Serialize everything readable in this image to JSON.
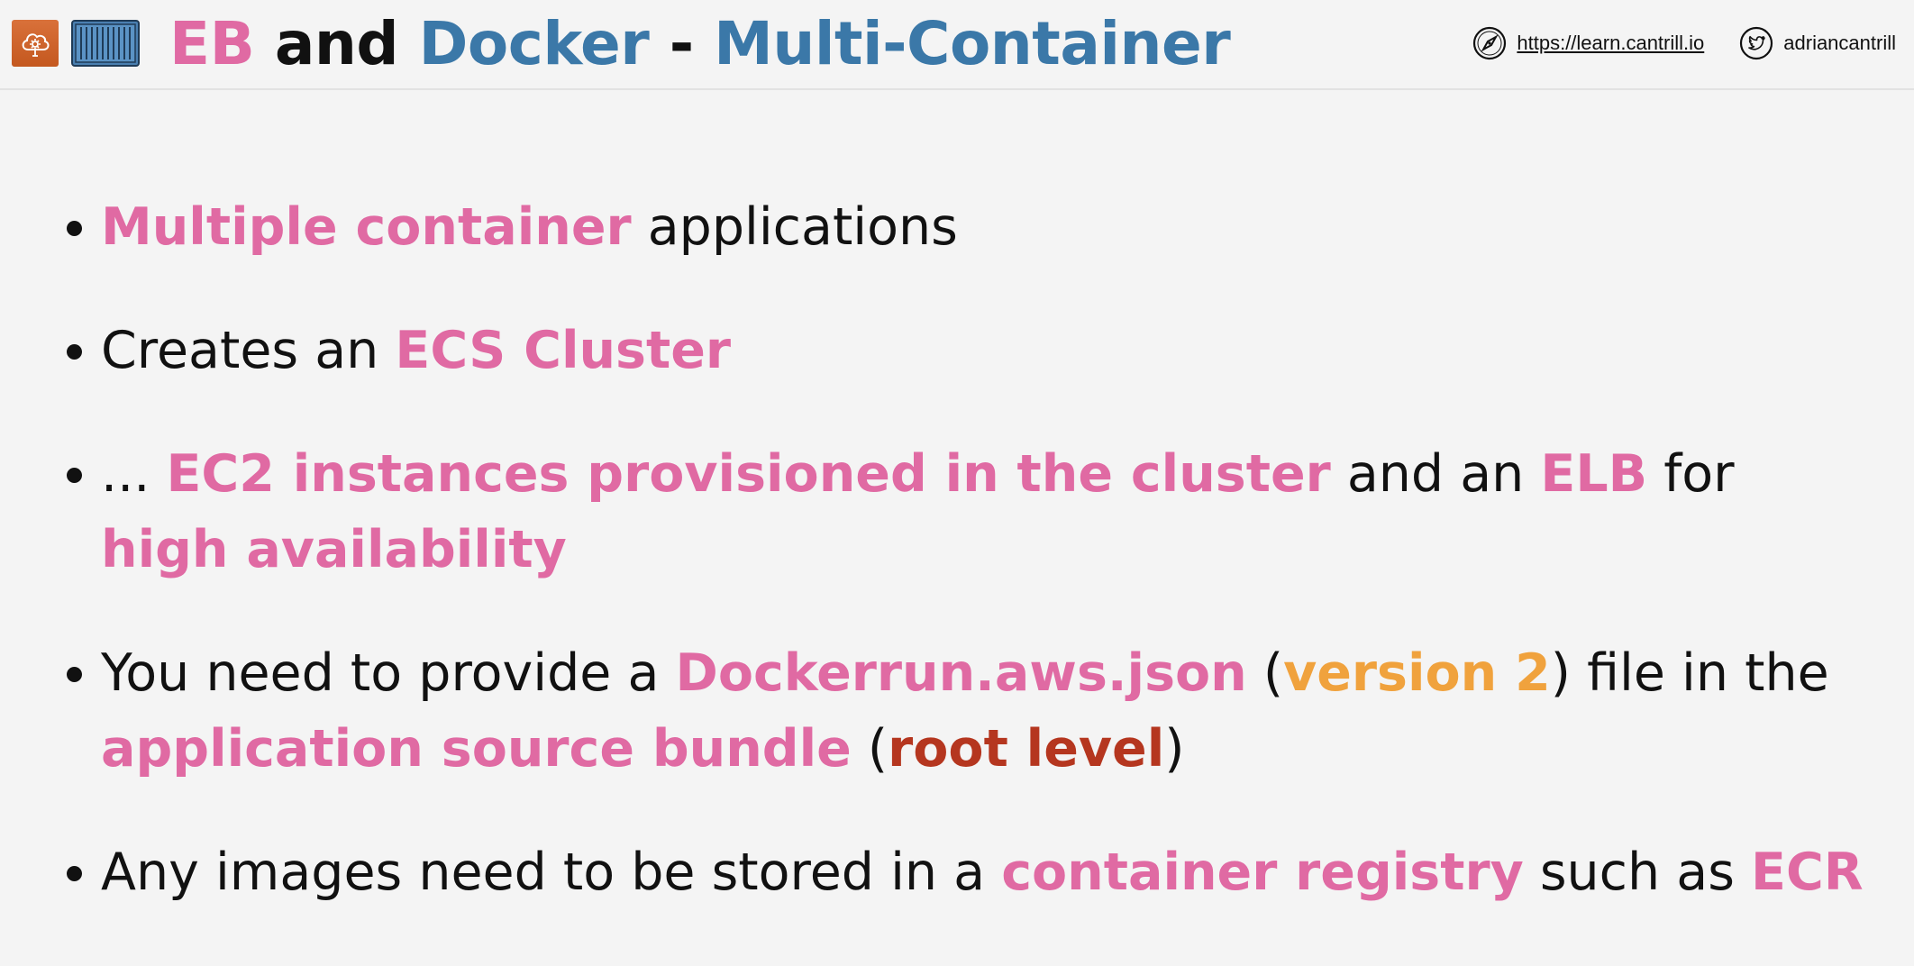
{
  "header": {
    "title": {
      "part1": "EB",
      "part2": " and ",
      "part3": "Docker",
      "part4": " - ",
      "part5": "Multi-Container"
    },
    "website": "https://learn.cantrill.io",
    "twitter": "adriancantrill",
    "icons": [
      "elastic-beanstalk-icon",
      "container-icon",
      "compass-icon",
      "twitter-bird-icon"
    ]
  },
  "bullets": [
    {
      "segments": [
        {
          "text": "Multiple container",
          "style": "pink"
        },
        {
          "text": " applications",
          "style": "normal"
        }
      ]
    },
    {
      "segments": [
        {
          "text": "Creates an ",
          "style": "normal"
        },
        {
          "text": "ECS Cluster",
          "style": "pink"
        }
      ]
    },
    {
      "segments": [
        {
          "text": "... ",
          "style": "normal"
        },
        {
          "text": "EC2 instances provisioned in the cluster",
          "style": "pink"
        },
        {
          "text": " and an ",
          "style": "normal"
        },
        {
          "text": "ELB",
          "style": "pink"
        },
        {
          "text": " for ",
          "style": "normal"
        },
        {
          "text": "high availability",
          "style": "pink"
        }
      ]
    },
    {
      "segments": [
        {
          "text": "You need to provide a ",
          "style": "normal"
        },
        {
          "text": "Dockerrun.aws.json",
          "style": "pink"
        },
        {
          "text": " (",
          "style": "normal"
        },
        {
          "text": "version 2",
          "style": "orange"
        },
        {
          "text": ") file in the ",
          "style": "normal"
        },
        {
          "text": "application source bundle",
          "style": "pink"
        },
        {
          "text": " (",
          "style": "normal"
        },
        {
          "text": "root level",
          "style": "red"
        },
        {
          "text": ")",
          "style": "normal"
        }
      ]
    },
    {
      "segments": [
        {
          "text": "Any images need to be stored in a ",
          "style": "normal"
        },
        {
          "text": "container registry",
          "style": "pink"
        },
        {
          "text": " such as ",
          "style": "normal"
        },
        {
          "text": "ECR",
          "style": "pink"
        }
      ]
    }
  ],
  "colors": {
    "pink": "#e06aa3",
    "blue": "#3b78a8",
    "orange": "#f0a23d",
    "red": "#b5361f",
    "background": "#f4f4f4"
  }
}
